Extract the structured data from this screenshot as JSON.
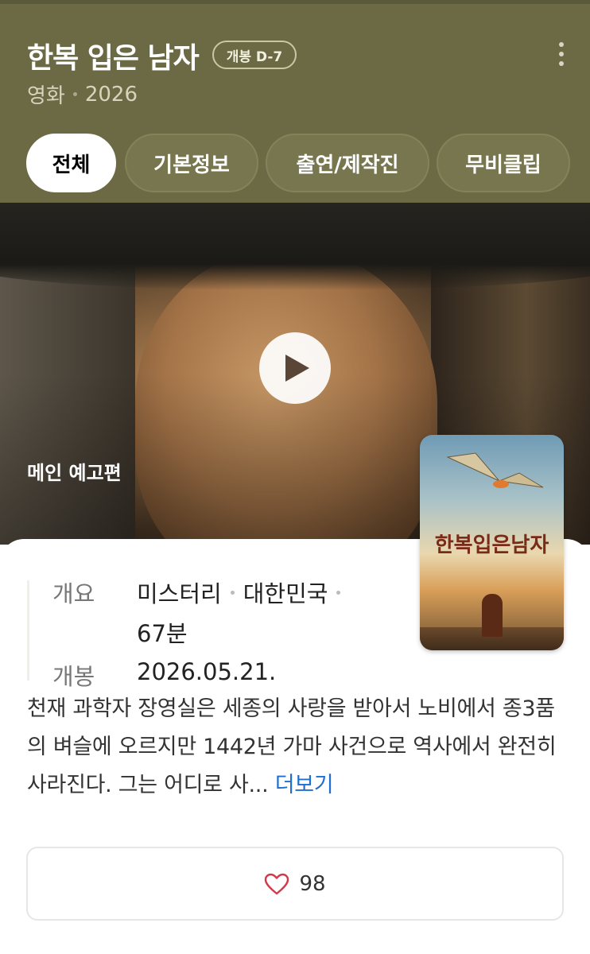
{
  "header": {
    "title": "한복 입은 남자",
    "badge": "개봉 D-7",
    "category": "영화",
    "year": "2026",
    "background_color": "#6b6a44"
  },
  "tabs": [
    {
      "label": "전체",
      "active": true
    },
    {
      "label": "기본정보",
      "active": false
    },
    {
      "label": "출연/제작진",
      "active": false
    },
    {
      "label": "무비클립",
      "active": false
    }
  ],
  "hero": {
    "label": "메인 예고편",
    "play_icon": "play-icon"
  },
  "poster": {
    "title": "한복입은남자"
  },
  "info": {
    "overview_label": "개요",
    "genre": "미스터리",
    "country": "대한민국",
    "runtime": "67분",
    "release_label": "개봉",
    "release_date": "2026.05.21."
  },
  "description": {
    "text": "천재 과학자 장영실은 세종의 사랑을 받아서 노비에서 종3품의 벼슬에 오르지만 1442년 가마 사건으로 역사에서 완전히 사라진다. 그는 어디로 사...",
    "more_label": "더보기",
    "link_color": "#1f6fd1"
  },
  "like": {
    "icon": "heart-icon",
    "count": "98"
  }
}
